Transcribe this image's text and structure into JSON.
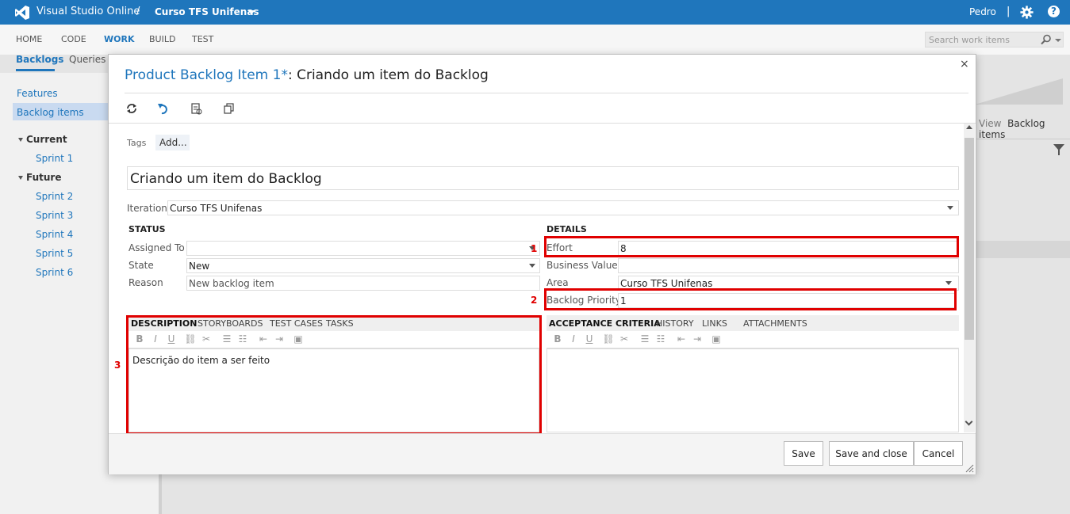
{
  "topbar": {
    "brand": "Visual Studio Online",
    "separator": "/",
    "project": "Curso TFS Unifenas",
    "user": "Pedro",
    "divider": "|",
    "help": "?"
  },
  "nav": {
    "items": [
      "HOME",
      "CODE",
      "WORK",
      "BUILD",
      "TEST"
    ],
    "active": "WORK",
    "search_placeholder": "Search work items"
  },
  "subtabs": {
    "backlogs": "Backlogs",
    "queries": "Queries"
  },
  "left_panel": {
    "features": "Features",
    "backlog_items": "Backlog items",
    "current": "Current",
    "current_sprints": [
      "Sprint 1"
    ],
    "future": "Future",
    "future_sprints": [
      "Sprint 2",
      "Sprint 3",
      "Sprint 4",
      "Sprint 5",
      "Sprint 6"
    ]
  },
  "background_right": {
    "view_label": "View",
    "view_value": "Backlog items"
  },
  "dialog": {
    "title_prefix": "Product Backlog Item 1*",
    "title_suffix": ": Criando um item do Backlog",
    "close": "×",
    "toolbar_icons": [
      "refresh-icon",
      "undo-icon",
      "copy-icon",
      "clone-icon"
    ],
    "tags_label": "Tags",
    "tags_add": "Add...",
    "title_value": "Criando um item do Backlog",
    "iteration_label": "Iteration",
    "iteration_value": "Curso TFS Unifenas",
    "status": {
      "heading": "STATUS",
      "assigned_to_label": "Assigned To",
      "assigned_to_value": "",
      "state_label": "State",
      "state_value": "New",
      "reason_label": "Reason",
      "reason_value": "New backlog item"
    },
    "details": {
      "heading": "DETAILS",
      "effort_label": "Effort",
      "effort_value": "8",
      "business_value_label": "Business Value",
      "business_value_value": "",
      "area_label": "Area",
      "area_value": "Curso TFS Unifenas",
      "backlog_priority_label": "Backlog Priority",
      "backlog_priority_value": "1"
    },
    "left_tabs": [
      "DESCRIPTION",
      "STORYBOARDS",
      "TEST CASES",
      "TASKS"
    ],
    "right_tabs": [
      "ACCEPTANCE CRITERIA",
      "HISTORY",
      "LINKS",
      "ATTACHMENTS"
    ],
    "description_text": "Descrição do item a ser feito",
    "annotations": [
      "1",
      "2",
      "3"
    ],
    "buttons": {
      "save": "Save",
      "save_close": "Save and close",
      "cancel": "Cancel"
    },
    "accent_color": "#1f76bc",
    "annotation_color": "#e00000"
  }
}
